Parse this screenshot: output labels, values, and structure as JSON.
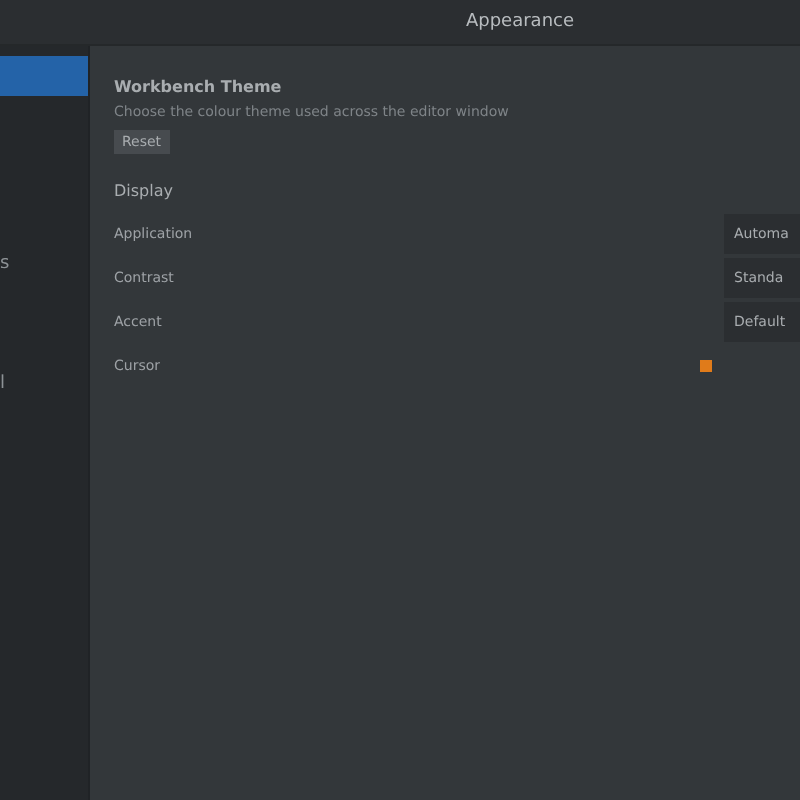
{
  "window": {
    "title": "Appearance"
  },
  "sidebar": {
    "items": [
      {
        "selected": true
      },
      {
        "label": "s",
        "selected": false
      },
      {
        "label": "l",
        "selected": false
      }
    ]
  },
  "section": {
    "title": "Workbench Theme",
    "description": "Choose the colour theme used across the editor window",
    "button": "Reset"
  },
  "group": {
    "title": "Display",
    "rows": [
      {
        "kind": "select",
        "label": "Application",
        "value": "Automa"
      },
      {
        "kind": "select",
        "label": "Contrast",
        "value": "Standa"
      },
      {
        "kind": "select",
        "label": "Accent",
        "value": "Default"
      },
      {
        "kind": "color",
        "label": "Cursor",
        "color": "#e07b1a"
      }
    ]
  }
}
